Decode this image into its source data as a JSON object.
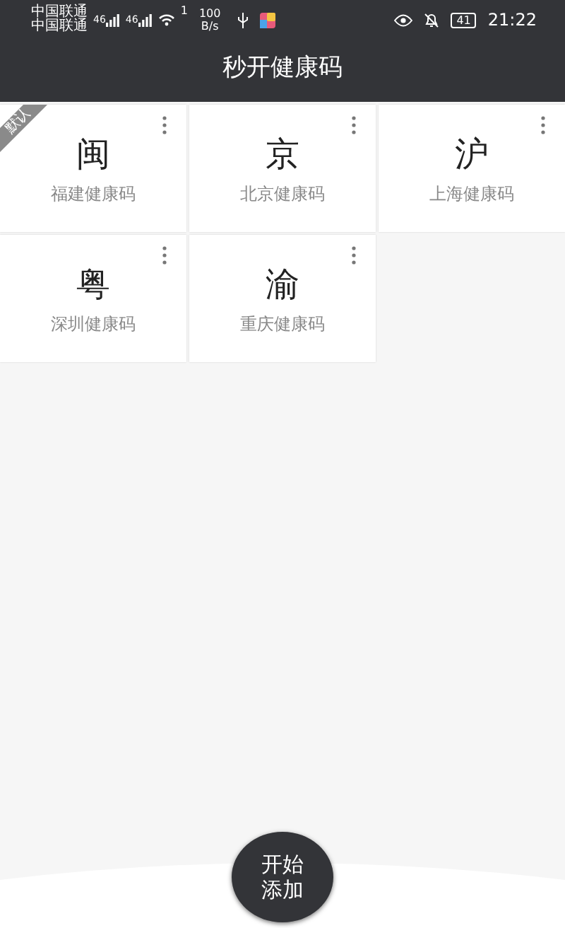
{
  "status_bar": {
    "carriers": [
      "中国联通",
      "中国联通"
    ],
    "network": [
      "46",
      "46"
    ],
    "wifi_badge": "1",
    "speed": [
      "100",
      "B/s"
    ],
    "battery": "41",
    "time": "21:22"
  },
  "title": "秒开健康码",
  "cards": [
    {
      "char": "闽",
      "label": "福建健康码",
      "default": true
    },
    {
      "char": "京",
      "label": "北京健康码",
      "default": false
    },
    {
      "char": "沪",
      "label": "上海健康码",
      "default": false
    },
    {
      "char": "粤",
      "label": "深圳健康码",
      "default": false
    },
    {
      "char": "渝",
      "label": "重庆健康码",
      "default": false
    }
  ],
  "default_ribbon": "默认",
  "fab": {
    "line1": "开始",
    "line2": "添加"
  }
}
